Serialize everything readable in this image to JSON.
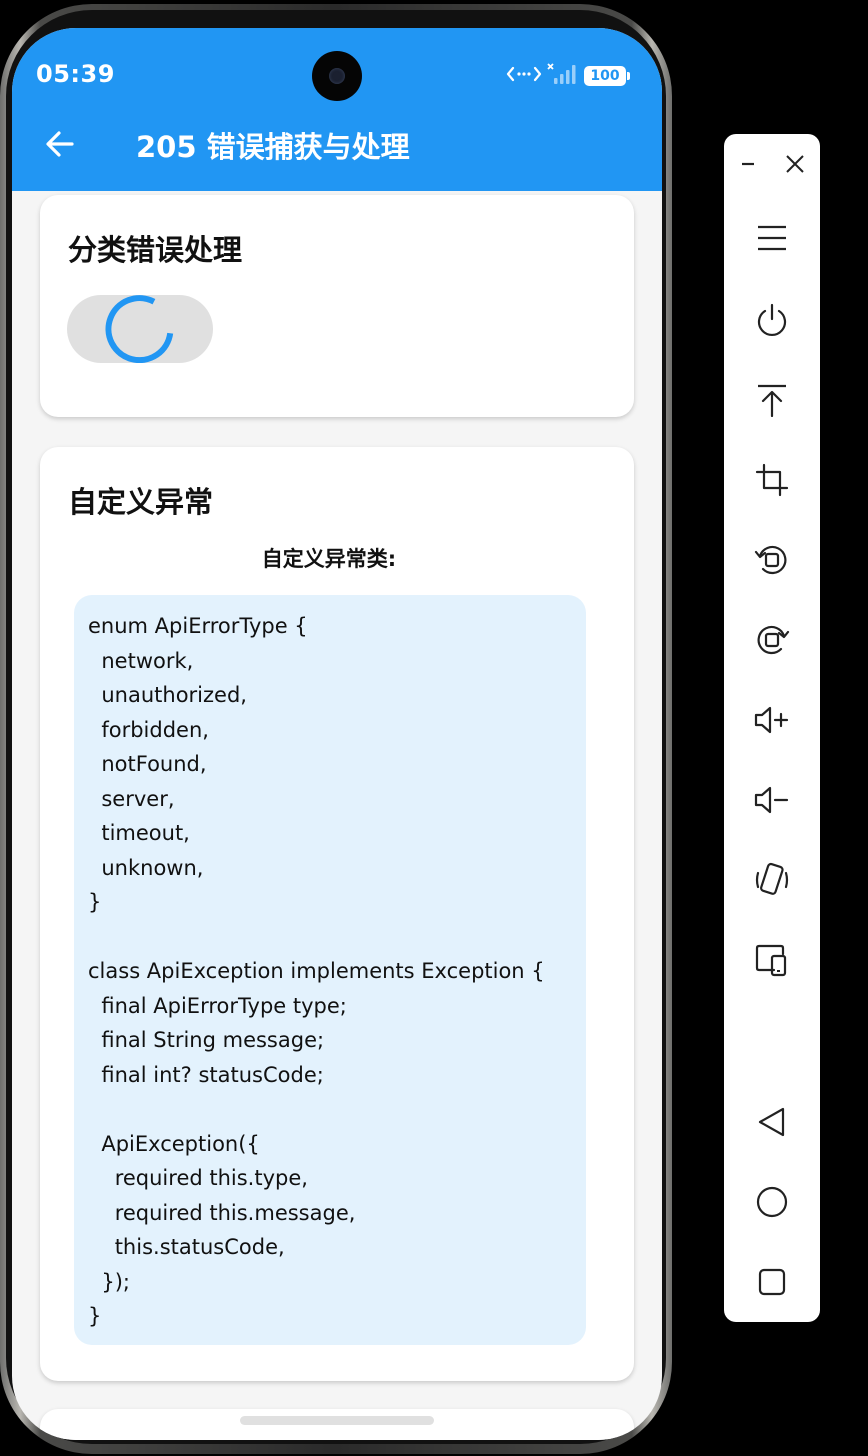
{
  "status_bar": {
    "time": "05:39",
    "battery": "100",
    "icons": [
      "data-transfer-icon",
      "signal-icon",
      "battery-icon"
    ]
  },
  "app_bar": {
    "title": "205 错误捕获与处理",
    "back_icon": "arrow-left-icon"
  },
  "sections": {
    "classified": {
      "title": "分类错误处理",
      "loading_indicator": "circular-progress"
    },
    "custom_exception": {
      "title": "自定义异常",
      "caption": "自定义异常类:",
      "code": "enum ApiErrorType {\n  network,\n  unauthorized,\n  forbidden,\n  notFound,\n  server,\n  timeout,\n  unknown,\n}\n\nclass ApiException implements Exception {\n  final ApiErrorType type;\n  final String message;\n  final int? statusCode;\n\n  ApiException({\n    required this.type,\n    required this.message,\n    this.statusCode,\n  });\n}"
    }
  },
  "side_toolbar": {
    "items": [
      "minimize-icon",
      "close-icon",
      "menu-icon",
      "power-icon",
      "upload-top-icon",
      "crop-icon",
      "rotate-left-icon",
      "rotate-right-icon",
      "volume-up-icon",
      "volume-down-icon",
      "shake-icon",
      "screen-mirror-icon",
      "back-nav-icon",
      "home-nav-icon",
      "recents-nav-icon"
    ]
  },
  "colors": {
    "primary": "#2196f3",
    "code_background": "#e3f2fd",
    "page_background": "#f5f5f5"
  }
}
